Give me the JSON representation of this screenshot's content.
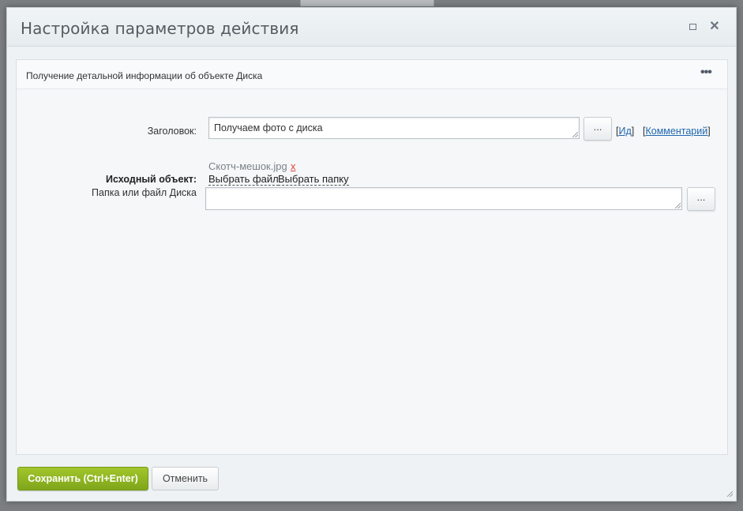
{
  "dialog": {
    "title": "Настройка параметров действия",
    "maximize_label": "",
    "close_label": "✕"
  },
  "panel": {
    "title": "Получение детальной информации об объекте Диска",
    "more_label": "•••"
  },
  "form": {
    "title_label": "Заголовок:",
    "title_value": "Получаем фото с диска",
    "title_dots": "...",
    "id_link": "Ид",
    "comment_link": "Комментарий",
    "source_label": "Исходный объект:",
    "selected_file": "Скотч-мешок.jpg",
    "remove_mark": "x",
    "choose_file": "Выбрать файл",
    "choose_folder": "Выбрать папку",
    "folder_label": "Папка или файл Диска",
    "folder_value": "",
    "folder_dots": "..."
  },
  "footer": {
    "save_label": "Сохранить (Ctrl+Enter)",
    "cancel_label": "Отменить"
  },
  "colors": {
    "save_button": "#8cb320",
    "link": "#2067b0",
    "remove_mark": "#e0413a"
  }
}
